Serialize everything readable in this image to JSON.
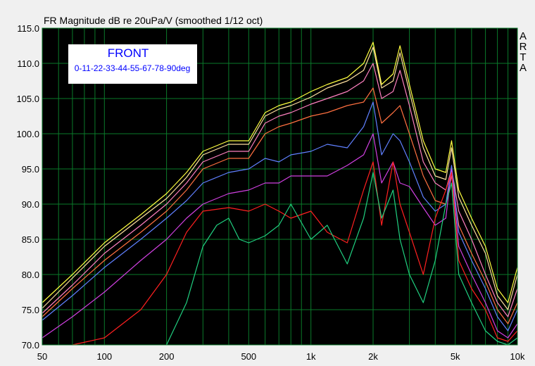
{
  "chart_data": {
    "type": "line",
    "title": "FR Magnitude dB re 20uPa/V (smoothed 1/12 oct)",
    "brand": [
      "A",
      "R",
      "T",
      "A"
    ],
    "legend_box": {
      "title": "FRONT",
      "subtitle": "0-11-22-33-44-55-67-78-90deg"
    },
    "x_scale": "log",
    "xlim": [
      50,
      10000
    ],
    "ylim": [
      70,
      115
    ],
    "grid": true,
    "background": "#000000",
    "grid_color": "#0a7a2a",
    "x_ticks": [
      {
        "value": 50,
        "label": "50"
      },
      {
        "value": 100,
        "label": "100"
      },
      {
        "value": 200,
        "label": "200"
      },
      {
        "value": 500,
        "label": "500"
      },
      {
        "value": 1000,
        "label": "1k"
      },
      {
        "value": 2000,
        "label": "2k"
      },
      {
        "value": 5000,
        "label": "5k"
      },
      {
        "value": 10000,
        "label": "10k"
      }
    ],
    "y_ticks": [
      {
        "value": 115,
        "label": "115.0"
      },
      {
        "value": 110,
        "label": "110.0"
      },
      {
        "value": 105,
        "label": "105.0"
      },
      {
        "value": 100,
        "label": "100.0"
      },
      {
        "value": 95,
        "label": "95.0"
      },
      {
        "value": 90,
        "label": "90.0"
      },
      {
        "value": 85,
        "label": "85.0"
      },
      {
        "value": 80,
        "label": "80.0"
      },
      {
        "value": 75,
        "label": "75.0"
      },
      {
        "value": 70,
        "label": "70.0"
      }
    ],
    "series": [
      {
        "color": "#ffff40",
        "points": [
          [
            50,
            76
          ],
          [
            70,
            80
          ],
          [
            100,
            84.5
          ],
          [
            150,
            88.5
          ],
          [
            200,
            91.5
          ],
          [
            250,
            94.5
          ],
          [
            300,
            97.5
          ],
          [
            400,
            99
          ],
          [
            500,
            99
          ],
          [
            600,
            103
          ],
          [
            700,
            104
          ],
          [
            800,
            104.5
          ],
          [
            1000,
            106
          ],
          [
            1200,
            107
          ],
          [
            1500,
            108
          ],
          [
            1800,
            110
          ],
          [
            2000,
            113
          ],
          [
            2200,
            107
          ],
          [
            2500,
            108.5
          ],
          [
            2700,
            112.5
          ],
          [
            3000,
            107
          ],
          [
            3500,
            99
          ],
          [
            4000,
            95
          ],
          [
            4500,
            94.5
          ],
          [
            4800,
            99
          ],
          [
            5200,
            92
          ],
          [
            6000,
            88
          ],
          [
            7000,
            84
          ],
          [
            8000,
            78
          ],
          [
            9000,
            76
          ],
          [
            10000,
            81
          ]
        ]
      },
      {
        "color": "#ffe0a0",
        "points": [
          [
            50,
            75.2
          ],
          [
            70,
            79.5
          ],
          [
            100,
            84
          ],
          [
            150,
            88
          ],
          [
            200,
            90.8
          ],
          [
            250,
            93.8
          ],
          [
            300,
            97
          ],
          [
            400,
            98.5
          ],
          [
            500,
            98.5
          ],
          [
            600,
            102.5
          ],
          [
            700,
            103.5
          ],
          [
            800,
            104
          ],
          [
            1000,
            105.2
          ],
          [
            1200,
            106.5
          ],
          [
            1500,
            107.5
          ],
          [
            1800,
            109
          ],
          [
            2000,
            112.3
          ],
          [
            2200,
            106.5
          ],
          [
            2500,
            107.5
          ],
          [
            2700,
            111.5
          ],
          [
            3000,
            106
          ],
          [
            3500,
            98
          ],
          [
            4000,
            94
          ],
          [
            4500,
            93.5
          ],
          [
            4800,
            98
          ],
          [
            5200,
            91
          ],
          [
            6000,
            87
          ],
          [
            7000,
            83
          ],
          [
            8000,
            77
          ],
          [
            9000,
            75
          ],
          [
            10000,
            80
          ]
        ]
      },
      {
        "color": "#ff80c0",
        "points": [
          [
            50,
            74.5
          ],
          [
            70,
            78.5
          ],
          [
            100,
            83
          ],
          [
            150,
            87
          ],
          [
            200,
            90
          ],
          [
            250,
            93
          ],
          [
            300,
            96
          ],
          [
            400,
            97.5
          ],
          [
            500,
            97.5
          ],
          [
            600,
            101.5
          ],
          [
            700,
            102.5
          ],
          [
            800,
            103
          ],
          [
            1000,
            104.2
          ],
          [
            1200,
            105
          ],
          [
            1500,
            106
          ],
          [
            1800,
            107.5
          ],
          [
            2000,
            110
          ],
          [
            2200,
            105
          ],
          [
            2500,
            106
          ],
          [
            2700,
            109
          ],
          [
            3000,
            104
          ],
          [
            3500,
            96
          ],
          [
            4000,
            93
          ],
          [
            4500,
            92
          ],
          [
            4800,
            95
          ],
          [
            5200,
            89
          ],
          [
            6000,
            85
          ],
          [
            7000,
            80
          ],
          [
            8000,
            76
          ],
          [
            9000,
            74
          ],
          [
            10000,
            78
          ]
        ]
      },
      {
        "color": "#ff7040",
        "points": [
          [
            50,
            74
          ],
          [
            70,
            78
          ],
          [
            100,
            82
          ],
          [
            150,
            86
          ],
          [
            200,
            89
          ],
          [
            250,
            92
          ],
          [
            300,
            95
          ],
          [
            400,
            96.5
          ],
          [
            500,
            96.5
          ],
          [
            600,
            100
          ],
          [
            700,
            101
          ],
          [
            800,
            101.5
          ],
          [
            1000,
            102.5
          ],
          [
            1200,
            103
          ],
          [
            1500,
            104
          ],
          [
            1800,
            104.5
          ],
          [
            2000,
            106.5
          ],
          [
            2200,
            101.5
          ],
          [
            2500,
            103
          ],
          [
            2700,
            104
          ],
          [
            3000,
            100
          ],
          [
            3500,
            94
          ],
          [
            4000,
            90.5
          ],
          [
            4500,
            90
          ],
          [
            4800,
            94
          ],
          [
            5200,
            87
          ],
          [
            6000,
            83
          ],
          [
            7000,
            79
          ],
          [
            8000,
            75
          ],
          [
            9000,
            73
          ],
          [
            10000,
            76
          ]
        ]
      },
      {
        "color": "#6080ff",
        "points": [
          [
            50,
            73.5
          ],
          [
            70,
            77
          ],
          [
            100,
            81
          ],
          [
            150,
            85
          ],
          [
            200,
            88
          ],
          [
            250,
            90.5
          ],
          [
            300,
            93
          ],
          [
            400,
            94.5
          ],
          [
            500,
            95
          ],
          [
            600,
            96.5
          ],
          [
            700,
            96
          ],
          [
            800,
            97
          ],
          [
            1000,
            97.5
          ],
          [
            1200,
            98.5
          ],
          [
            1500,
            98
          ],
          [
            1800,
            101
          ],
          [
            2000,
            104.5
          ],
          [
            2200,
            97
          ],
          [
            2500,
            100
          ],
          [
            2700,
            99
          ],
          [
            3000,
            96
          ],
          [
            3500,
            91
          ],
          [
            4000,
            89
          ],
          [
            4500,
            90
          ],
          [
            4800,
            95.5
          ],
          [
            5200,
            86
          ],
          [
            6000,
            82
          ],
          [
            7000,
            78
          ],
          [
            8000,
            74
          ],
          [
            9000,
            72
          ],
          [
            10000,
            75
          ]
        ]
      },
      {
        "color": "#d040e0",
        "points": [
          [
            50,
            71
          ],
          [
            70,
            74
          ],
          [
            100,
            77.5
          ],
          [
            150,
            82
          ],
          [
            200,
            85
          ],
          [
            250,
            88
          ],
          [
            300,
            90
          ],
          [
            400,
            91.5
          ],
          [
            500,
            92
          ],
          [
            600,
            93
          ],
          [
            700,
            93
          ],
          [
            800,
            94
          ],
          [
            1000,
            94
          ],
          [
            1200,
            94
          ],
          [
            1500,
            95.5
          ],
          [
            1800,
            97
          ],
          [
            2000,
            100
          ],
          [
            2200,
            93
          ],
          [
            2500,
            96
          ],
          [
            2700,
            93
          ],
          [
            3000,
            92.5
          ],
          [
            3500,
            89.5
          ],
          [
            4000,
            87
          ],
          [
            4500,
            88
          ],
          [
            4800,
            95
          ],
          [
            5200,
            84
          ],
          [
            6000,
            80
          ],
          [
            7000,
            76
          ],
          [
            8000,
            72
          ],
          [
            9000,
            71
          ],
          [
            10000,
            73
          ]
        ]
      },
      {
        "color": "#ff2020",
        "points": [
          [
            70,
            70
          ],
          [
            100,
            71
          ],
          [
            150,
            75
          ],
          [
            200,
            80
          ],
          [
            250,
            86
          ],
          [
            300,
            89
          ],
          [
            400,
            89.5
          ],
          [
            500,
            89
          ],
          [
            600,
            90
          ],
          [
            700,
            89
          ],
          [
            800,
            88
          ],
          [
            1000,
            89
          ],
          [
            1200,
            86
          ],
          [
            1500,
            84.5
          ],
          [
            1800,
            92
          ],
          [
            2000,
            96
          ],
          [
            2200,
            87
          ],
          [
            2500,
            96
          ],
          [
            2700,
            90
          ],
          [
            3000,
            86
          ],
          [
            3500,
            80
          ],
          [
            4000,
            88
          ],
          [
            4500,
            92
          ],
          [
            4800,
            94.5
          ],
          [
            5200,
            82
          ],
          [
            6000,
            78
          ],
          [
            7000,
            75
          ],
          [
            8000,
            71
          ],
          [
            9000,
            70.5
          ],
          [
            10000,
            72
          ]
        ]
      },
      {
        "color": "#20d080",
        "points": [
          [
            200,
            70
          ],
          [
            250,
            76
          ],
          [
            300,
            84
          ],
          [
            350,
            87
          ],
          [
            400,
            88
          ],
          [
            450,
            85
          ],
          [
            500,
            84.5
          ],
          [
            600,
            85.5
          ],
          [
            700,
            87
          ],
          [
            800,
            90
          ],
          [
            1000,
            85
          ],
          [
            1200,
            87
          ],
          [
            1500,
            81.5
          ],
          [
            1800,
            88
          ],
          [
            2000,
            94.5
          ],
          [
            2200,
            88
          ],
          [
            2500,
            92
          ],
          [
            2700,
            85
          ],
          [
            3000,
            80
          ],
          [
            3500,
            76
          ],
          [
            4000,
            82
          ],
          [
            4500,
            90
          ],
          [
            4800,
            93
          ],
          [
            5200,
            80
          ],
          [
            6000,
            76
          ],
          [
            7000,
            72
          ],
          [
            8000,
            70.5
          ],
          [
            9000,
            70
          ],
          [
            10000,
            71
          ]
        ]
      }
    ]
  }
}
